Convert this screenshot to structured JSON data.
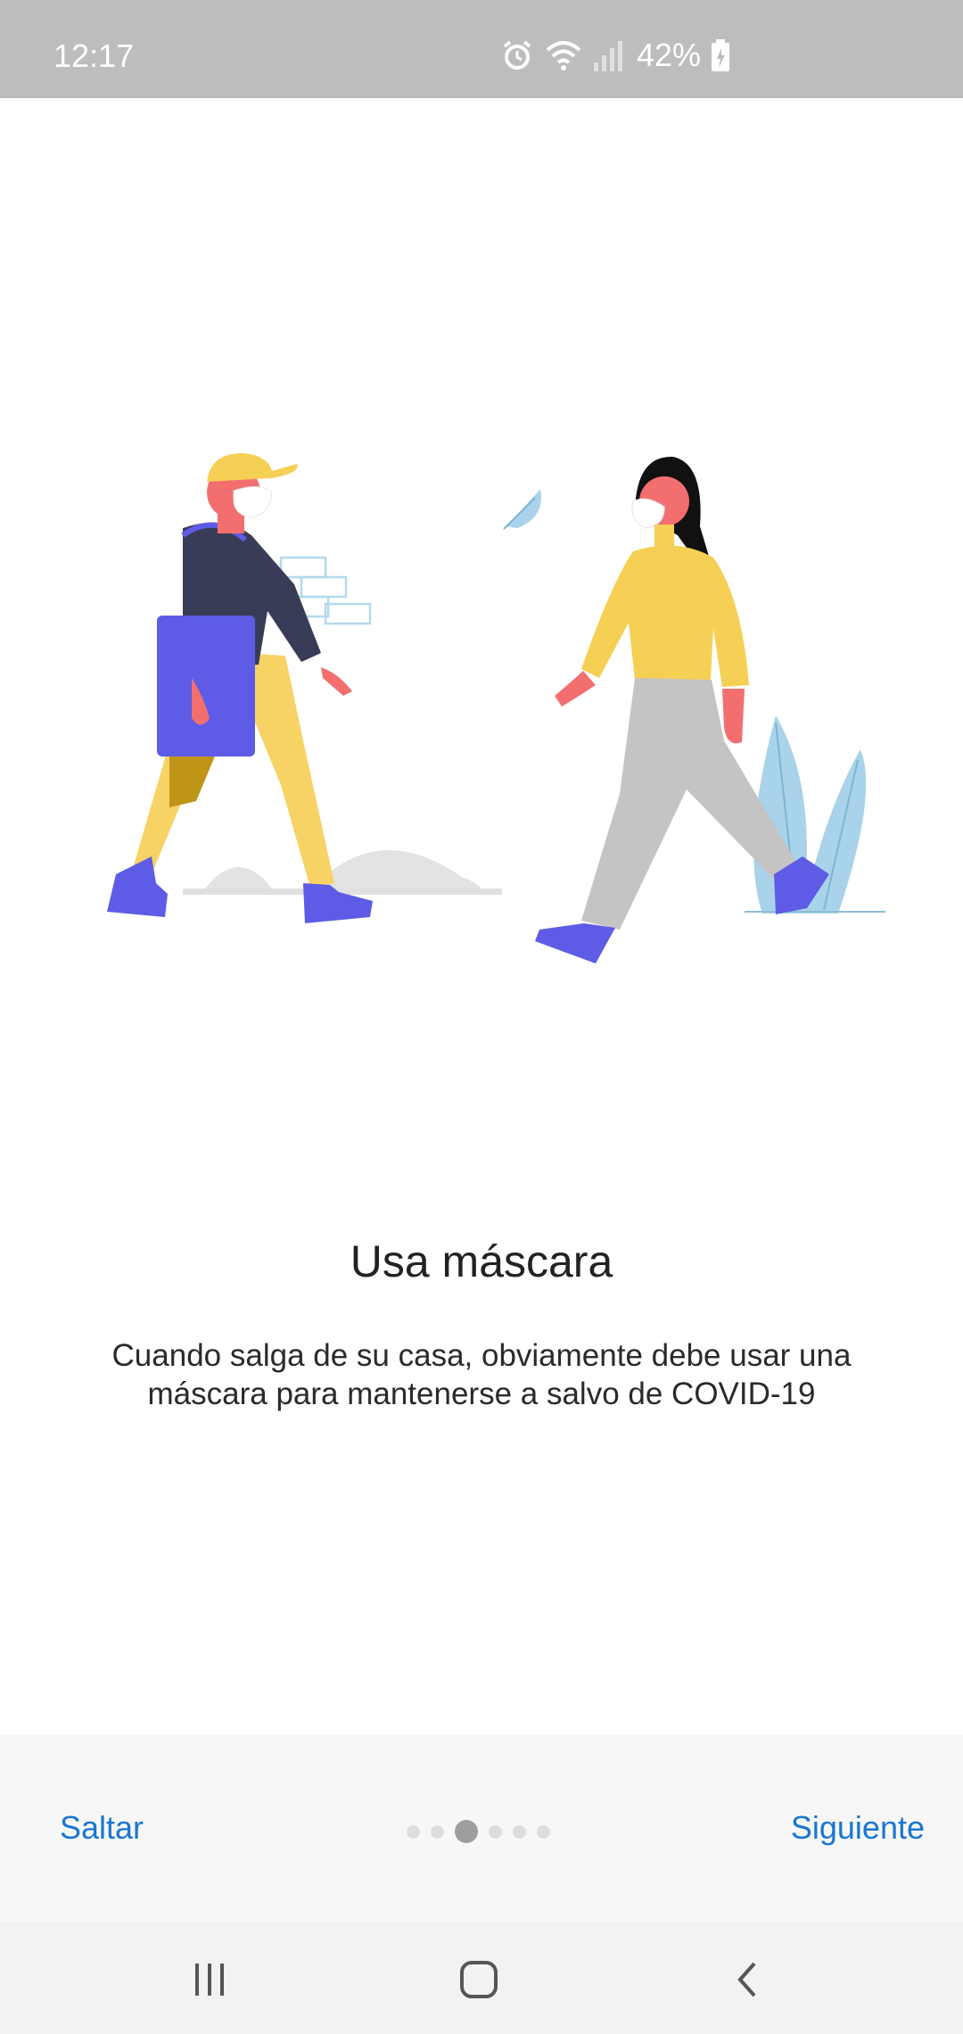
{
  "status_bar": {
    "time": "12:17",
    "battery_pct": "42%",
    "icons": [
      "alarm-icon",
      "wifi-icon",
      "cell-signal-icon",
      "battery-charging-icon"
    ]
  },
  "onboarding": {
    "title": "Usa máscara",
    "description": "Cuando salga de su casa, obviamente debe usar una máscara para mantenerse a salvo de COVID-19",
    "illustration": "two-people-wearing-masks-illustration"
  },
  "footer": {
    "skip_label": "Saltar",
    "next_label": "Siguiente",
    "page_indicator": {
      "total": 6,
      "current": 3
    },
    "accent_color": "#1976d2"
  },
  "system_nav": {
    "icons": [
      "recent-apps-icon",
      "home-icon",
      "back-icon"
    ]
  }
}
